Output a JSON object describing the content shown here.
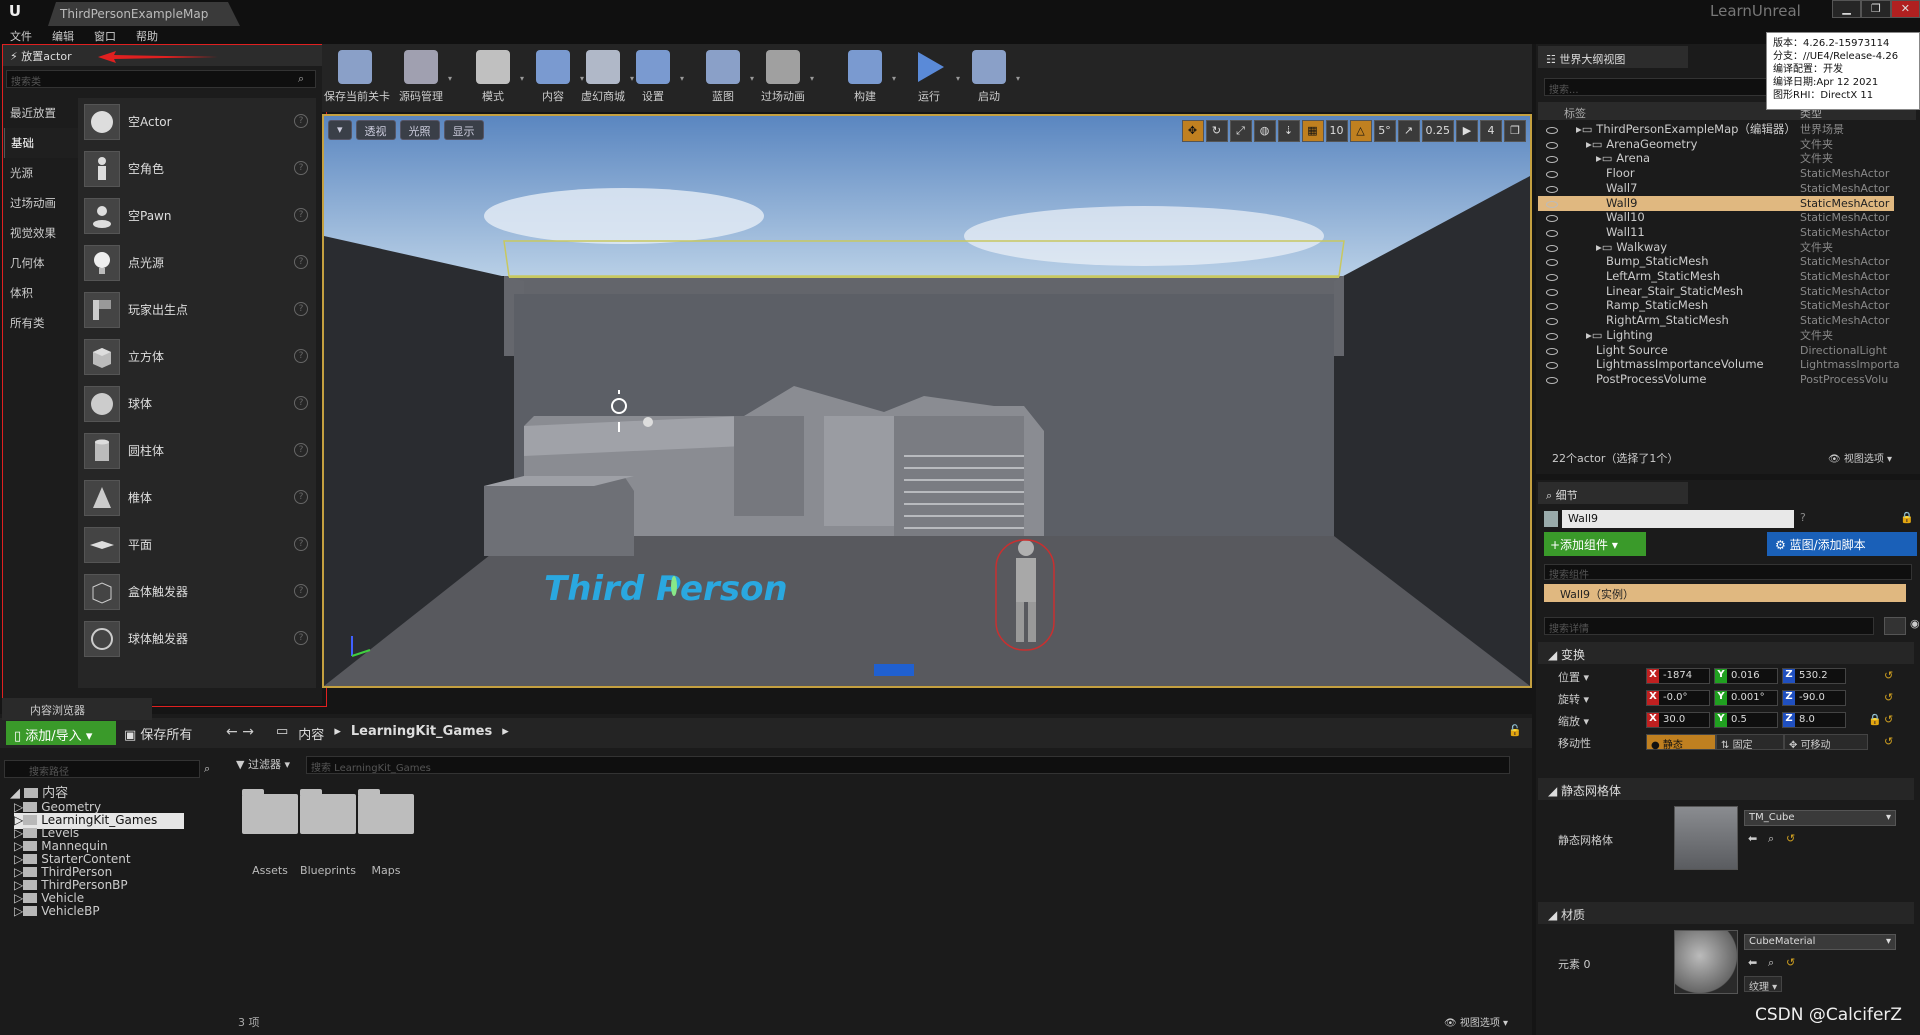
{
  "window": {
    "tab_title": "ThirdPersonExampleMap",
    "brand": "LearnUnreal",
    "logo": "U"
  },
  "menu": [
    "文件",
    "编辑",
    "窗口",
    "帮助"
  ],
  "place_actor": {
    "tab_label": "放置actor",
    "search_placeholder": "搜索类",
    "categories": [
      "最近放置",
      "基础",
      "光源",
      "过场动画",
      "视觉效果",
      "几何体",
      "体积",
      "所有类"
    ],
    "selected_category": "基础",
    "items": [
      "空Actor",
      "空角色",
      "空Pawn",
      "点光源",
      "玩家出生点",
      "立方体",
      "球体",
      "圆柱体",
      "椎体",
      "平面",
      "盒体触发器",
      "球体触发器"
    ]
  },
  "toolbar": {
    "buttons": [
      {
        "label": "保存当前关卡",
        "icon": "save-icon",
        "color": "#8aa0c8"
      },
      {
        "label": "源码管理",
        "icon": "source-control-icon",
        "color": "#a0a0b0"
      },
      {
        "label": "模式",
        "icon": "modes-icon",
        "color": "#c0c0c0"
      },
      {
        "label": "内容",
        "icon": "content-icon",
        "color": "#7a9ad0"
      },
      {
        "label": "虚幻商城",
        "icon": "marketplace-icon",
        "color": "#b0b8c8"
      },
      {
        "label": "设置",
        "icon": "settings-icon",
        "color": "#7a9ad0"
      },
      {
        "label": "蓝图",
        "icon": "blueprint-icon",
        "color": "#8aa0c8"
      },
      {
        "label": "过场动画",
        "icon": "cinematics-icon",
        "color": "#a0a0a0"
      },
      {
        "label": "构建",
        "icon": "build-icon",
        "color": "#7a9ad0"
      },
      {
        "label": "运行",
        "icon": "play-icon",
        "color": "#5a8ad8"
      },
      {
        "label": "启动",
        "icon": "launch-icon",
        "color": "#8aa0c8"
      }
    ]
  },
  "viewport": {
    "perspective": "透视",
    "lighting": "光照",
    "show": "显示",
    "grid_snap": "10",
    "rot_snap": "5°",
    "scale_snap": "0.25",
    "cam_speed": "4",
    "floor_text": "Third Person",
    "sky_color": "#7aa0d0",
    "wall_color": "#4a4c52"
  },
  "outliner": {
    "tab_label": "世界大纲视图",
    "search_placeholder": "搜索...",
    "col_label": "标签",
    "col_type": "类型",
    "rows": [
      {
        "name": "ThirdPersonExampleMap（编辑器）",
        "type": "世界场景",
        "level": 0
      },
      {
        "name": "ArenaGeometry",
        "type": "文件夹",
        "level": 1
      },
      {
        "name": "Arena",
        "type": "文件夹",
        "level": 2
      },
      {
        "name": "Floor",
        "type": "StaticMeshActor",
        "level": 3
      },
      {
        "name": "Wall7",
        "type": "StaticMeshActor",
        "level": 3
      },
      {
        "name": "Wall9",
        "type": "StaticMeshActor",
        "level": 3,
        "selected": true
      },
      {
        "name": "Wall10",
        "type": "StaticMeshActor",
        "level": 3
      },
      {
        "name": "Wall11",
        "type": "StaticMeshActor",
        "level": 3
      },
      {
        "name": "Walkway",
        "type": "文件夹",
        "level": 2
      },
      {
        "name": "Bump_StaticMesh",
        "type": "StaticMeshActor",
        "level": 3
      },
      {
        "name": "LeftArm_StaticMesh",
        "type": "StaticMeshActor",
        "level": 3
      },
      {
        "name": "Linear_Stair_StaticMesh",
        "type": "StaticMeshActor",
        "level": 3
      },
      {
        "name": "Ramp_StaticMesh",
        "type": "StaticMeshActor",
        "level": 3
      },
      {
        "name": "RightArm_StaticMesh",
        "type": "StaticMeshActor",
        "level": 3
      },
      {
        "name": "Lighting",
        "type": "文件夹",
        "level": 1
      },
      {
        "name": "Light Source",
        "type": "DirectionalLight",
        "level": 2
      },
      {
        "name": "LightmassImportanceVolume",
        "type": "LightmassImporta",
        "level": 2
      },
      {
        "name": "PostProcessVolume",
        "type": "PostProcessVolu",
        "level": 2
      }
    ],
    "footer": "22个actor（选择了1个）",
    "view_options": "视图选项"
  },
  "version_info": [
    "版本：4.26.2-15973114",
    "分支：//UE4/Release-4.26",
    "编译配置：开发",
    "编译日期:Apr 12 2021",
    "图形RHI：DirectX 11"
  ],
  "details": {
    "tab_label": "细节",
    "actor_name": "Wall9",
    "add_component": "+添加组件",
    "blueprint_button": "蓝图/添加脚本",
    "component_search": "搜索组件",
    "component_row": "Wall9（实例）",
    "details_search": "搜索详情",
    "transform_section": "变换",
    "location_label": "位置",
    "location": [
      "-1874",
      "0.016",
      "530.2"
    ],
    "rotation_label": "旋转",
    "rotation": [
      "-0.0°",
      "0.001°",
      "-90.0"
    ],
    "scale_label": "缩放",
    "scale": [
      "30.0",
      "0.5",
      "8.0"
    ],
    "mobility_label": "移动性",
    "mobility": [
      "静态",
      "固定",
      "可移动"
    ],
    "static_mesh_section": "静态网格体",
    "static_mesh_label": "静态网格体",
    "static_mesh_value": "TM_Cube",
    "materials_section": "材质",
    "element_label": "元素 0",
    "material_value": "CubeMaterial",
    "texture_btn": "纹理"
  },
  "content_browser": {
    "tab_label": "内容浏览器",
    "add_import": "添加/导入",
    "save_all": "保存所有",
    "breadcrumb": [
      "内容",
      "LearningKit_Games"
    ],
    "path_search": "搜索路径",
    "filters": "过滤器",
    "asset_search": "搜索 LearningKit_Games",
    "tree_root": "内容",
    "tree": [
      "Geometry",
      "LearningKit_Games",
      "Levels",
      "Mannequin",
      "StarterContent",
      "ThirdPerson",
      "ThirdPersonBP",
      "Vehicle",
      "VehicleBP"
    ],
    "tree_selected": "LearningKit_Games",
    "folders": [
      "Assets",
      "Blueprints",
      "Maps"
    ],
    "count": "3 项",
    "view_options": "视图选项"
  },
  "watermark": "CSDN @CalciferZ"
}
